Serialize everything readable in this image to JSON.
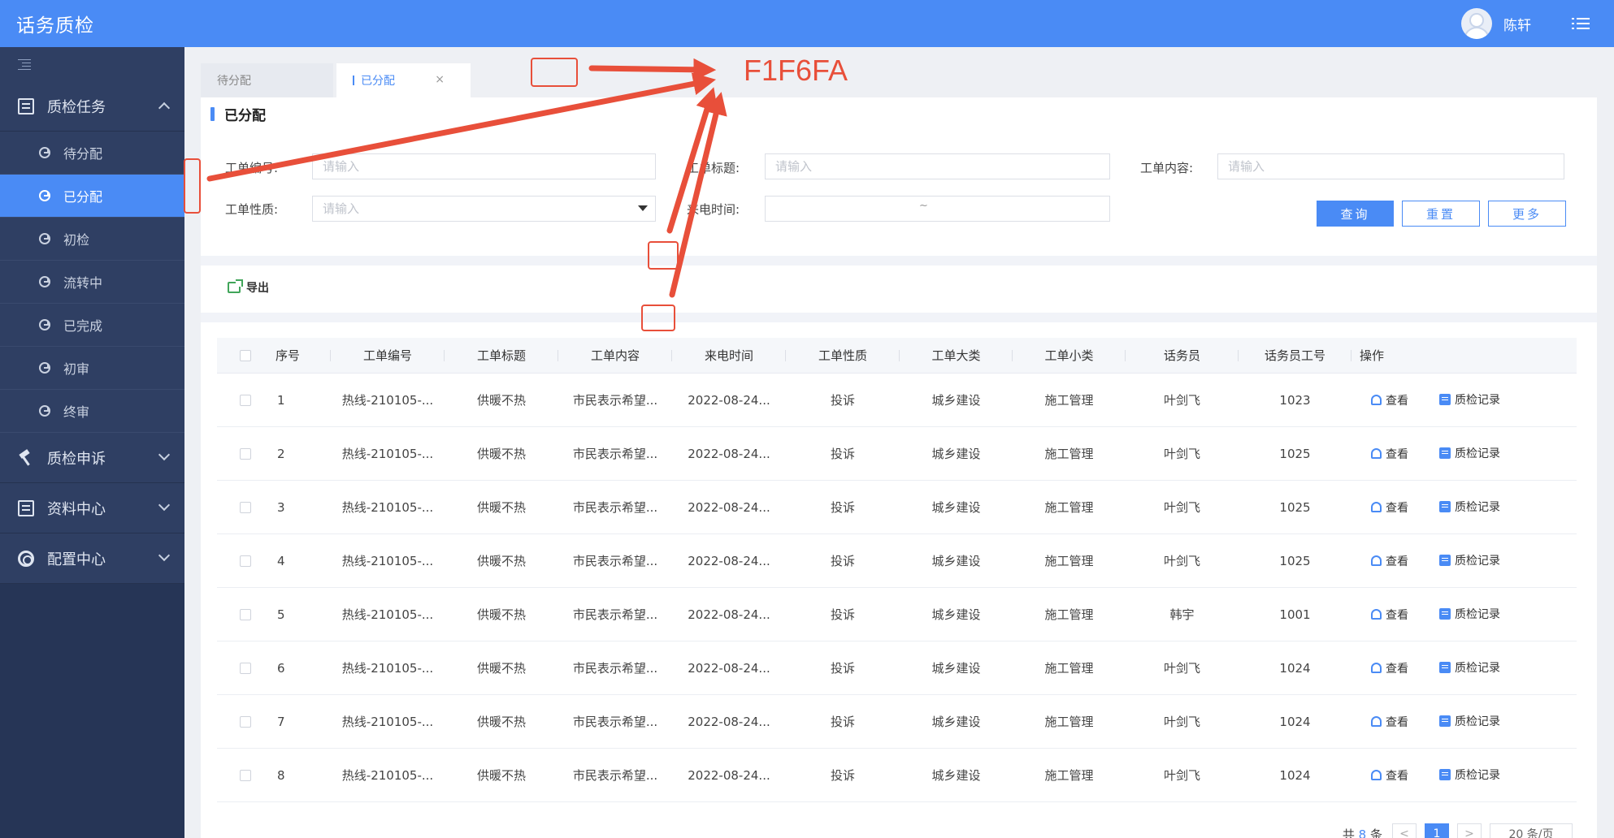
{
  "header": {
    "app_title": "话务质检",
    "user_name": "陈轩"
  },
  "sidebar": {
    "groups": [
      {
        "label": "质检任务",
        "expanded": true
      },
      {
        "label": "质检申诉",
        "expanded": false
      },
      {
        "label": "资料中心",
        "expanded": false
      },
      {
        "label": "配置中心",
        "expanded": false
      }
    ],
    "sub_items": [
      {
        "label": "待分配",
        "active": false
      },
      {
        "label": "已分配",
        "active": true
      },
      {
        "label": "初检",
        "active": false
      },
      {
        "label": "流转中",
        "active": false
      },
      {
        "label": "已完成",
        "active": false
      },
      {
        "label": "初审",
        "active": false
      },
      {
        "label": "终审",
        "active": false
      }
    ]
  },
  "tabs": [
    {
      "label": "待分配"
    },
    {
      "label": "已分配",
      "active": true,
      "close": "×"
    }
  ],
  "section_title": "已分配",
  "filters": {
    "order_no_label": "工单编号:",
    "order_title_label": "工单标题:",
    "order_content_label": "工单内容:",
    "order_nature_label": "工单性质:",
    "call_time_label": "来电时间:",
    "placeholder": "请输入",
    "range_separator": "~"
  },
  "buttons": {
    "query": "查询",
    "reset": "重置",
    "more": "更多"
  },
  "export_label": "导出",
  "table": {
    "headers": [
      "序号",
      "工单编号",
      "工单标题",
      "工单内容",
      "来电时间",
      "工单性质",
      "工单大类",
      "工单小类",
      "话务员",
      "话务员工号",
      "操作"
    ],
    "view_label": "查看",
    "record_label": "质检记录",
    "rows": [
      {
        "no": "1",
        "order_no": "热线-210105-...",
        "title": "供暖不热",
        "content": "市民表示希望...",
        "time": "2022-08-24...",
        "nature": "投诉",
        "major": "城乡建设",
        "minor": "施工管理",
        "agent": "叶剑飞",
        "agent_id": "1023"
      },
      {
        "no": "2",
        "order_no": "热线-210105-...",
        "title": "供暖不热",
        "content": "市民表示希望...",
        "time": "2022-08-24...",
        "nature": "投诉",
        "major": "城乡建设",
        "minor": "施工管理",
        "agent": "叶剑飞",
        "agent_id": "1025"
      },
      {
        "no": "3",
        "order_no": "热线-210105-...",
        "title": "供暖不热",
        "content": "市民表示希望...",
        "time": "2022-08-24...",
        "nature": "投诉",
        "major": "城乡建设",
        "minor": "施工管理",
        "agent": "叶剑飞",
        "agent_id": "1025"
      },
      {
        "no": "4",
        "order_no": "热线-210105-...",
        "title": "供暖不热",
        "content": "市民表示希望...",
        "time": "2022-08-24...",
        "nature": "投诉",
        "major": "城乡建设",
        "minor": "施工管理",
        "agent": "叶剑飞",
        "agent_id": "1025"
      },
      {
        "no": "5",
        "order_no": "热线-210105-...",
        "title": "供暖不热",
        "content": "市民表示希望...",
        "time": "2022-08-24...",
        "nature": "投诉",
        "major": "城乡建设",
        "minor": "施工管理",
        "agent": "韩宇",
        "agent_id": "1001"
      },
      {
        "no": "6",
        "order_no": "热线-210105-...",
        "title": "供暖不热",
        "content": "市民表示希望...",
        "time": "2022-08-24...",
        "nature": "投诉",
        "major": "城乡建设",
        "minor": "施工管理",
        "agent": "叶剑飞",
        "agent_id": "1024"
      },
      {
        "no": "7",
        "order_no": "热线-210105-...",
        "title": "供暖不热",
        "content": "市民表示希望...",
        "time": "2022-08-24...",
        "nature": "投诉",
        "major": "城乡建设",
        "minor": "施工管理",
        "agent": "叶剑飞",
        "agent_id": "1024"
      },
      {
        "no": "8",
        "order_no": "热线-210105-...",
        "title": "供暖不热",
        "content": "市民表示希望...",
        "time": "2022-08-24...",
        "nature": "投诉",
        "major": "城乡建设",
        "minor": "施工管理",
        "agent": "叶剑飞",
        "agent_id": "1024"
      }
    ]
  },
  "pagination": {
    "total_prefix": "共",
    "total_count": "8",
    "total_suffix": "条",
    "prev": "<",
    "current_page": "1",
    "next": ">",
    "page_size": "20 条/页"
  },
  "annotation": {
    "color_label": "F1F6FA"
  },
  "colors": {
    "header_bg": "#4a8bf5",
    "sidebar_bg": "#263556",
    "accent": "#4a8bf5",
    "annotation": "#e84f3a",
    "page_bg": "#eef0f4",
    "band": "#f1f3f8"
  },
  "icons": {
    "header_menu": "menu-list-icon",
    "sidebar_collapse": "indent-icon",
    "task_group": "clipboard-icon",
    "appeal_group": "gavel-icon",
    "resource_group": "book-icon",
    "config_group": "gear-icon",
    "sub_item": "pie-clock-icon",
    "export": "export-icon",
    "view": "user-view-icon",
    "record": "record-icon"
  }
}
